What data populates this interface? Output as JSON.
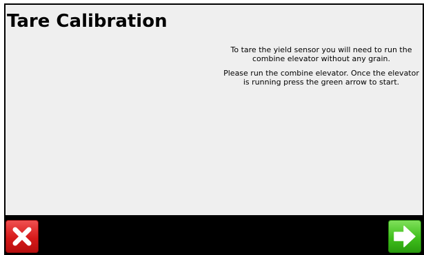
{
  "screen": {
    "title": "Tare Calibration",
    "instructions": {
      "paragraph_1": "To tare the yield sensor you will need to run the combine elevator without any grain.",
      "paragraph_2": "Please run the combine elevator.  Once the elevator is running press the green arrow to start."
    }
  },
  "bottom_bar": {
    "cancel_button": {
      "icon": "close-icon",
      "color": "#d61a1a"
    },
    "next_button": {
      "icon": "arrow-right-icon",
      "color": "#3fbf1c"
    }
  },
  "colors": {
    "background": "#efefef",
    "frame": "#000000"
  }
}
